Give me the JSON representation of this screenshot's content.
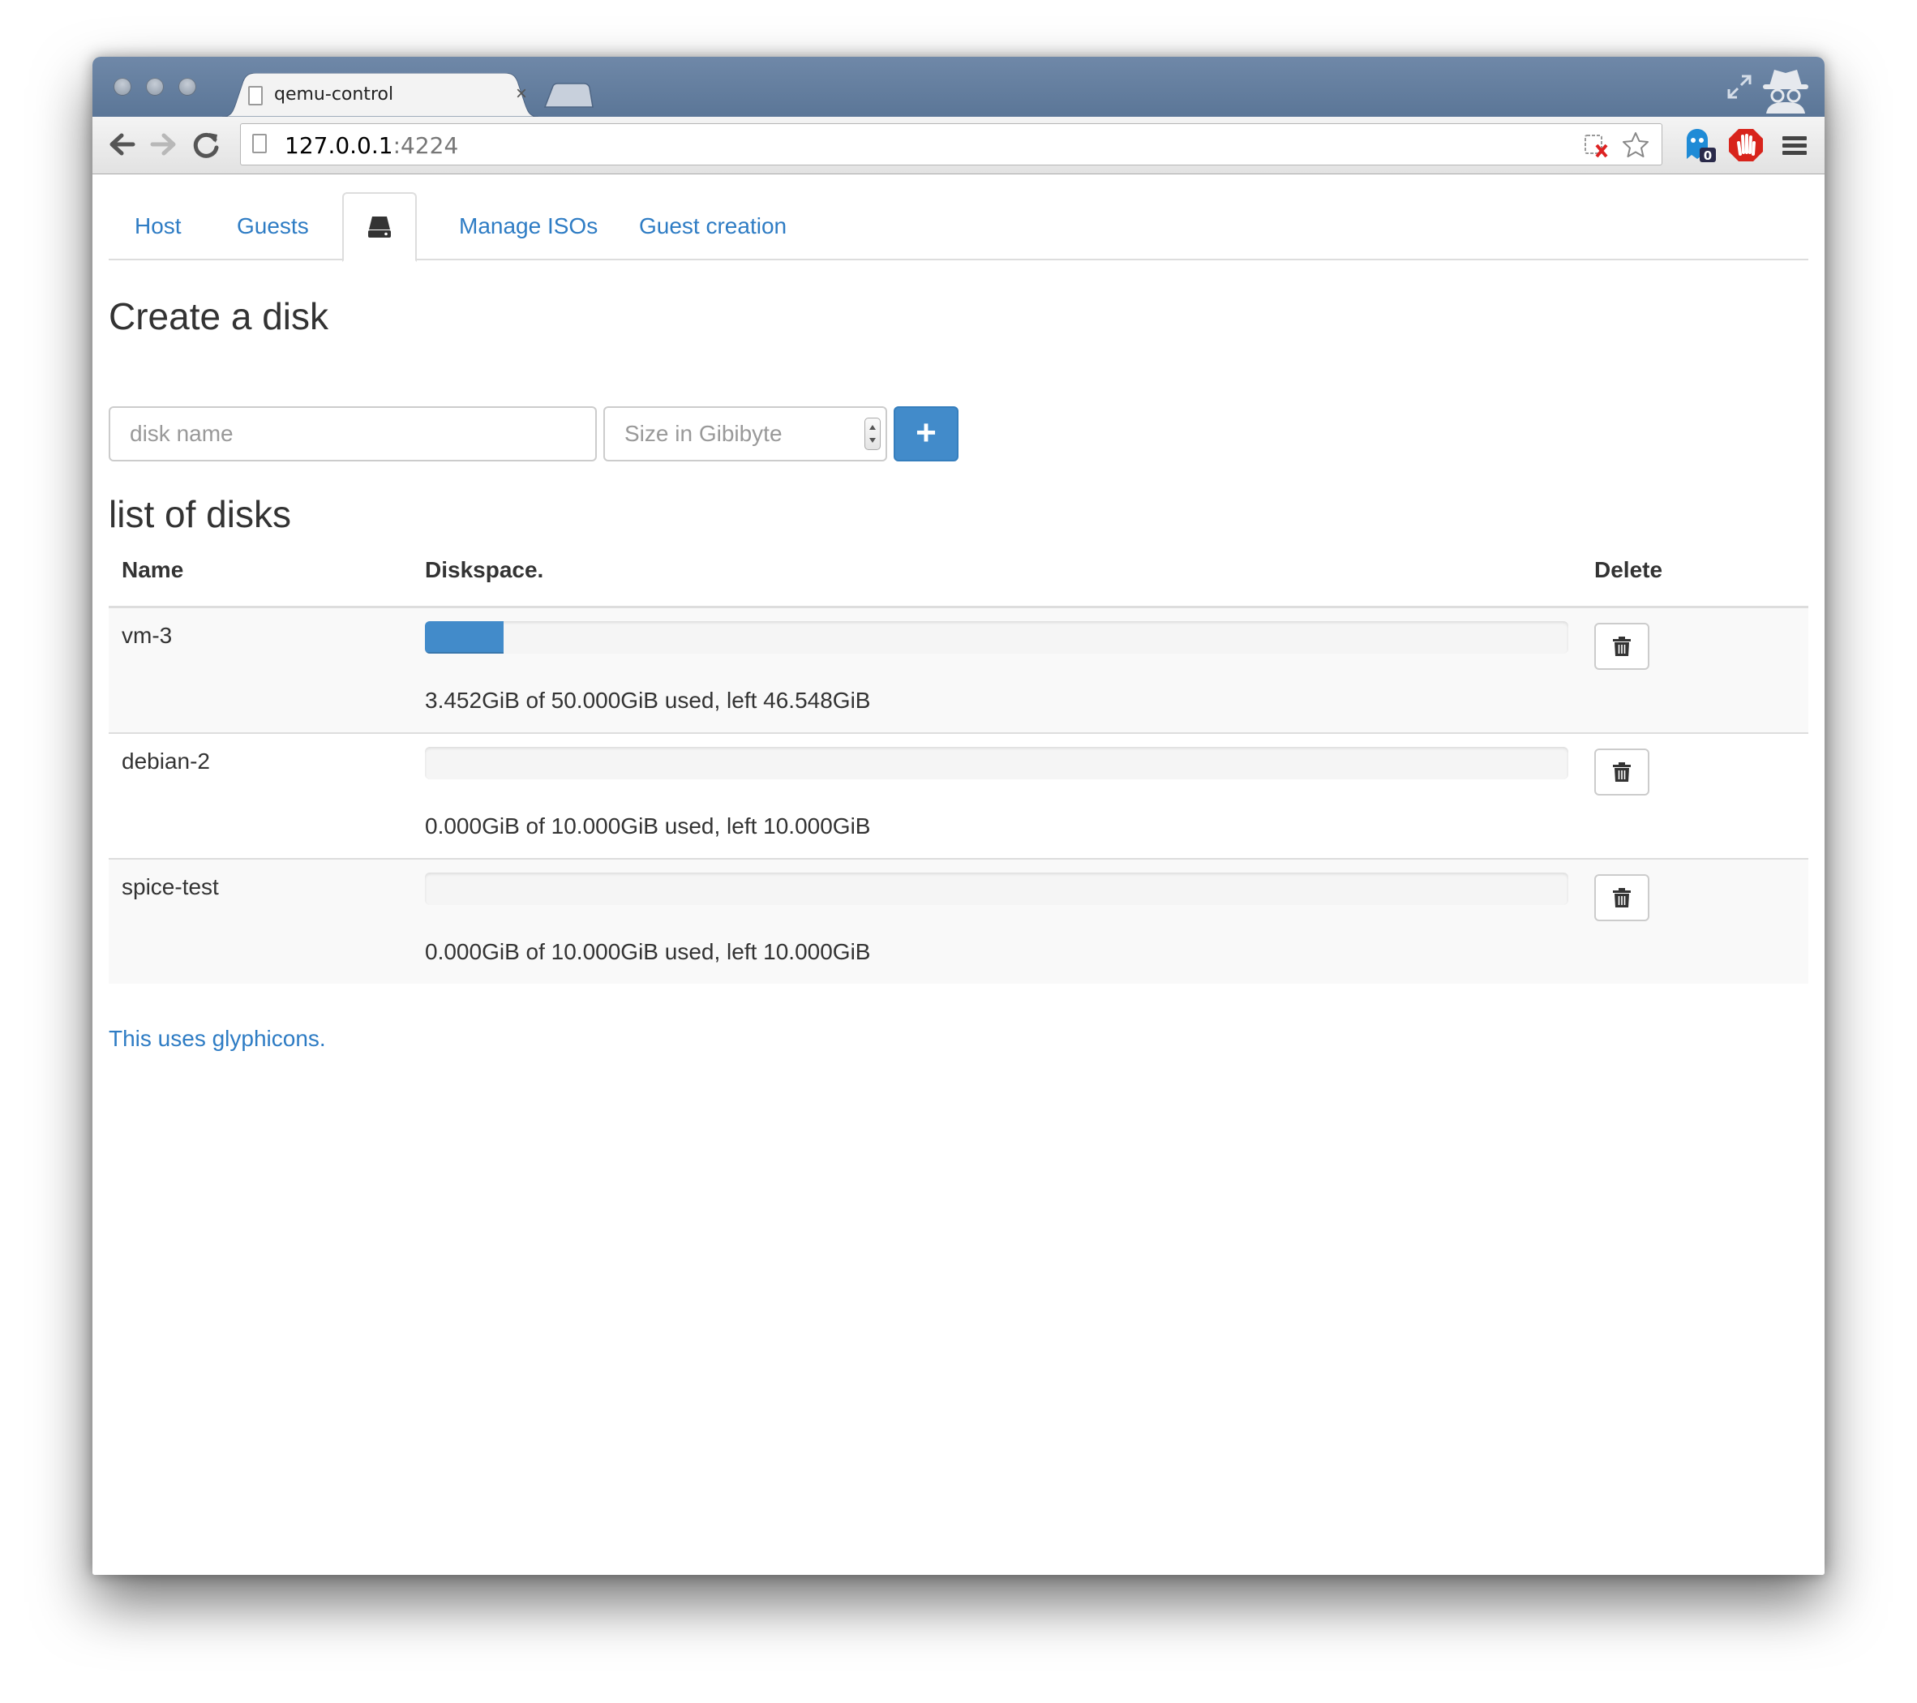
{
  "browser": {
    "tab_title": "qemu-control",
    "tab_close": "×",
    "url_host": "127.0.0.1",
    "url_port": ":4224",
    "extension_badge": "0"
  },
  "nav": {
    "tabs": [
      {
        "label": "Host"
      },
      {
        "label": "Guests"
      },
      {
        "label": "",
        "icon": "hdd-icon",
        "active": true
      },
      {
        "label": "Manage ISOs"
      },
      {
        "label": "Guest creation"
      }
    ]
  },
  "create": {
    "heading": "Create a disk",
    "name_placeholder": "disk name",
    "size_placeholder": "Size in Gibibyte",
    "add_label": "+"
  },
  "list": {
    "heading": "list of disks",
    "columns": [
      "Name",
      "Diskspace.",
      "Delete"
    ],
    "rows": [
      {
        "name": "vm-3",
        "used_fraction": 0.069,
        "usage": "3.452GiB of 50.000GiB used, left 46.548GiB"
      },
      {
        "name": "debian-2",
        "used_fraction": 0.0,
        "usage": "0.000GiB of 10.000GiB used, left 10.000GiB"
      },
      {
        "name": "spice-test",
        "used_fraction": 0.0,
        "usage": "0.000GiB of 10.000GiB used, left 10.000GiB"
      }
    ]
  },
  "footer": {
    "link": "This uses glyphicons."
  },
  "colors": {
    "accent": "#428bca",
    "link": "#2e7cc4",
    "titlebar": "#5b7697"
  }
}
